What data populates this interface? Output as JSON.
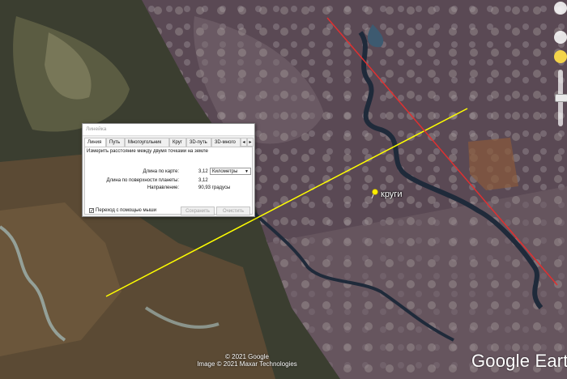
{
  "map": {
    "placemark_label": "круги",
    "copyright_lines": [
      "© 2021 Google",
      "Image © 2021 Maxar Technologies"
    ],
    "logo_text": "Google Earth",
    "ruler_color": "#ffff00",
    "path_color": "#e03030"
  },
  "ruler": {
    "title": "Линейка",
    "tabs": [
      {
        "label": "Линия",
        "active": true
      },
      {
        "label": "Путь",
        "active": false
      },
      {
        "label": "Многоугольник",
        "active": false
      },
      {
        "label": "Круг",
        "active": false
      },
      {
        "label": "3D-путь",
        "active": false
      },
      {
        "label": "3D-много",
        "active": false
      }
    ],
    "instruction": "Измерить расстояние между двумя точками на земле",
    "map_length_label": "Длина по карте:",
    "map_length_value": "3,12",
    "units_selected": "Километры",
    "ground_length_label": "Длина по поверхности планеты:",
    "ground_length_value": "3,12",
    "heading_label": "Направление:",
    "heading_value": "90,93 градусы",
    "mouse_nav_label": "Переход с помощью мыши",
    "mouse_nav_checked": "✓",
    "save_label": "Сохранить",
    "clear_label": "Очистить"
  }
}
